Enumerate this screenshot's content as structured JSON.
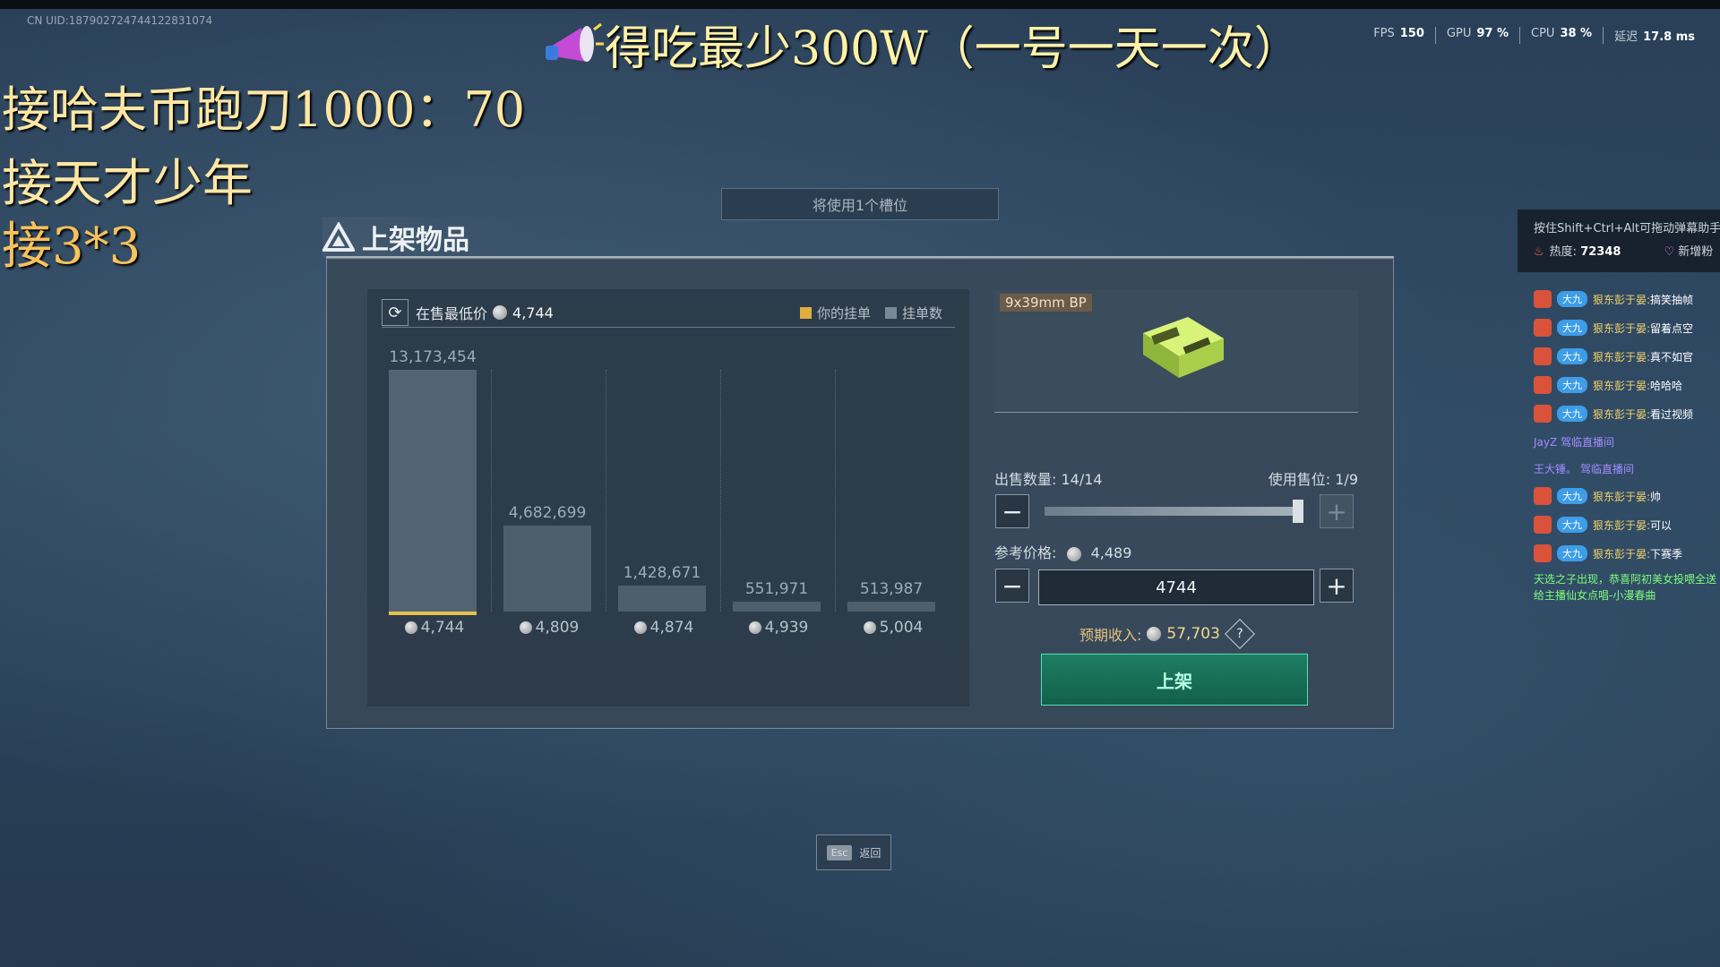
{
  "overlay": {
    "uid": "CN UID:187902724744122831074",
    "banner": "得吃最少300W（一号一天一次）",
    "line1": "接哈夫币跑刀1000：70",
    "line2": "接天才少年",
    "line3": "接3*3"
  },
  "perf": {
    "fps_label": "FPS",
    "fps": "150",
    "gpu_label": "GPU",
    "gpu": "97 %",
    "cpu_label": "CPU",
    "cpu": "38 %",
    "latency_label": "延迟",
    "latency": "17.8 ms"
  },
  "slot_hint": "将使用1个槽位",
  "panel": {
    "title": "上架物品",
    "lowest_label": "在售最低价",
    "lowest_price": "4,744",
    "legend_yours": "你的挂单",
    "legend_count": "挂单数",
    "colors": {
      "yours": "#e1ad3e",
      "count": "#7a8896",
      "list_button": "#1e7e63"
    }
  },
  "chart_data": {
    "type": "bar",
    "categories": [
      "4,744",
      "4,809",
      "4,874",
      "4,939",
      "5,004"
    ],
    "values": [
      13173454,
      4682699,
      1428671,
      551971,
      513987
    ],
    "value_labels": [
      "13,173,454",
      "4,682,699",
      "1,428,671",
      "551,971",
      "513,987"
    ],
    "series": [
      {
        "values": [
          13173454,
          4682699,
          1428671,
          551971,
          513987
        ]
      }
    ],
    "xlabel": "",
    "ylabel": ""
  },
  "item": {
    "tag": "9x39mm BP",
    "qty_label": "出售数量:",
    "qty": "14/14",
    "slots_label": "使用售位:",
    "slots": "1/9",
    "qty_fill": 1.0,
    "ref_label": "参考价格:",
    "ref_price": "4,489",
    "price_input": "4744",
    "income_label": "预期收入:",
    "income": "57,703",
    "help": "?",
    "list_button": "上架"
  },
  "esc": {
    "key": "Esc",
    "label": "返回"
  },
  "chat": {
    "hint": "按住Shift+Ctrl+Alt可拖动弹幕助手",
    "heat_label": "热度:",
    "heat": "72348",
    "new_label": "新增粉",
    "badge": "大九",
    "messages": [
      {
        "name": "狠东彭于晏:",
        "text": "搞笑抽帧"
      },
      {
        "name": "狠东彭于晏:",
        "text": "留着点空"
      },
      {
        "name": "狠东彭于晏:",
        "text": "真不如官"
      },
      {
        "name": "狠东彭于晏:",
        "text": "哈哈哈"
      },
      {
        "name": "狠东彭于晏:",
        "text": "看过视频"
      }
    ],
    "system1": "JayZ 驾临直播间",
    "system2": "王大锤。 驾临直播间",
    "messages2": [
      {
        "name": "狠东彭于晏:",
        "text": "帅"
      },
      {
        "name": "狠东彭于晏:",
        "text": "可以"
      },
      {
        "name": "狠东彭于晏:",
        "text": "下赛季"
      }
    ],
    "gift": "天选之子出现，恭喜阿初美女投喂全送给主播仙女点唱-小漫春曲"
  }
}
